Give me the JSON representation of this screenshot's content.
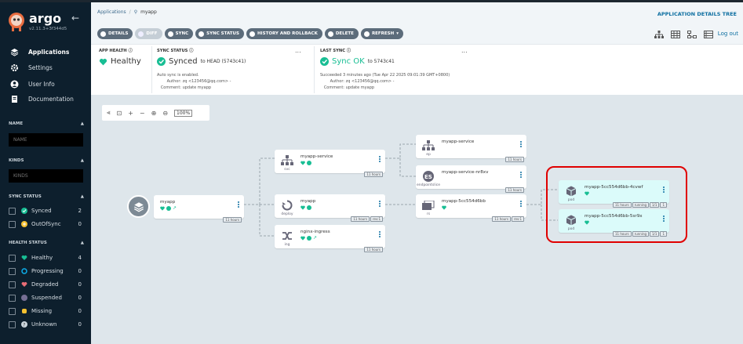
{
  "sidebar": {
    "brand": "argo",
    "version": "v2.11.3+3f344d5",
    "nav": [
      {
        "label": "Applications",
        "icon": "layers-icon"
      },
      {
        "label": "Settings",
        "icon": "gears-icon"
      },
      {
        "label": "User Info",
        "icon": "user-icon"
      },
      {
        "label": "Documentation",
        "icon": "book-icon"
      }
    ],
    "name_header": "NAME",
    "name_placeholder": "NAME",
    "kinds_header": "KINDS",
    "kinds_placeholder": "KINDS",
    "sync_header": "SYNC STATUS",
    "sync_filters": [
      {
        "label": "Synced",
        "count": "2",
        "color": "#18be94"
      },
      {
        "label": "OutOfSync",
        "count": "0",
        "color": "#f4c030"
      }
    ],
    "health_header": "HEALTH STATUS",
    "health_filters": [
      {
        "label": "Healthy",
        "count": "4",
        "color": "#18be94"
      },
      {
        "label": "Progressing",
        "count": "0",
        "color": "#0dadea"
      },
      {
        "label": "Degraded",
        "count": "0",
        "color": "#e96d76"
      },
      {
        "label": "Suspended",
        "count": "0",
        "color": "#766f94"
      },
      {
        "label": "Missing",
        "count": "0",
        "color": "#f4c030"
      },
      {
        "label": "Unknown",
        "count": "0",
        "color": "#ccd6dd"
      }
    ]
  },
  "header": {
    "breadcrumb_root": "Applications",
    "breadcrumb_current": "myapp",
    "page_title": "APPLICATION DETAILS TREE",
    "toolbar": [
      "DETAILS",
      "DIFF",
      "SYNC",
      "SYNC STATUS",
      "HISTORY AND ROLLBACK",
      "DELETE",
      "REFRESH"
    ],
    "logout": "Log out"
  },
  "status": {
    "app_health_label": "APP HEALTH",
    "app_health_value": "Healthy",
    "sync_status_label": "SYNC STATUS",
    "sync_status_value": "Synced",
    "sync_to": "to HEAD (5743c41)",
    "auto_sync": "Auto sync is enabled.",
    "sync_author_label": "Author:",
    "sync_author": "zq <123456@qq.com> -",
    "sync_comment_label": "Comment:",
    "sync_comment": "update myapp",
    "last_sync_label": "LAST SYNC",
    "last_sync_value": "Sync OK",
    "last_sync_to": "to 5743c41",
    "last_sync_time": "Succeeded 3 minutes ago (Tue Apr 22 2025 09:01:39 GMT+0800)",
    "last_author_label": "Author:",
    "last_author": "zq <123456@qq.com> -",
    "last_comment_label": "Comment:",
    "last_comment": "update myapp",
    "more": "..."
  },
  "canvas": {
    "zoom": "100%",
    "nodes": {
      "app": {
        "name": "myapp",
        "tag": "11 hours"
      },
      "svc": {
        "kind": "svc",
        "name": "myapp-service",
        "tag": "11 hours"
      },
      "deploy": {
        "kind": "deploy",
        "name": "myapp",
        "tags": [
          "11 hours",
          "rev:1"
        ]
      },
      "ing": {
        "kind": "ing",
        "name": "nginx-ingress",
        "tag": "11 hours"
      },
      "ep": {
        "kind": "ep",
        "name": "myapp-service",
        "tag": "11 hours"
      },
      "eps": {
        "kind": "endpointslice",
        "name": "myapp-service-nr8xv",
        "tag": "11 hours"
      },
      "rs": {
        "kind": "rs",
        "name": "myapp-5cc554d6bb",
        "tags": [
          "11 hours",
          "rev:1"
        ]
      },
      "pod1": {
        "kind": "pod",
        "name": "myapp-5cc554d6bb-4cvwf",
        "tags": [
          "11 hours",
          "running",
          "1/1",
          "1"
        ]
      },
      "pod2": {
        "kind": "pod",
        "name": "myapp-5cc554d6bb-5sr9x",
        "tags": [
          "11 hours",
          "running",
          "1/1",
          "1"
        ]
      }
    }
  }
}
